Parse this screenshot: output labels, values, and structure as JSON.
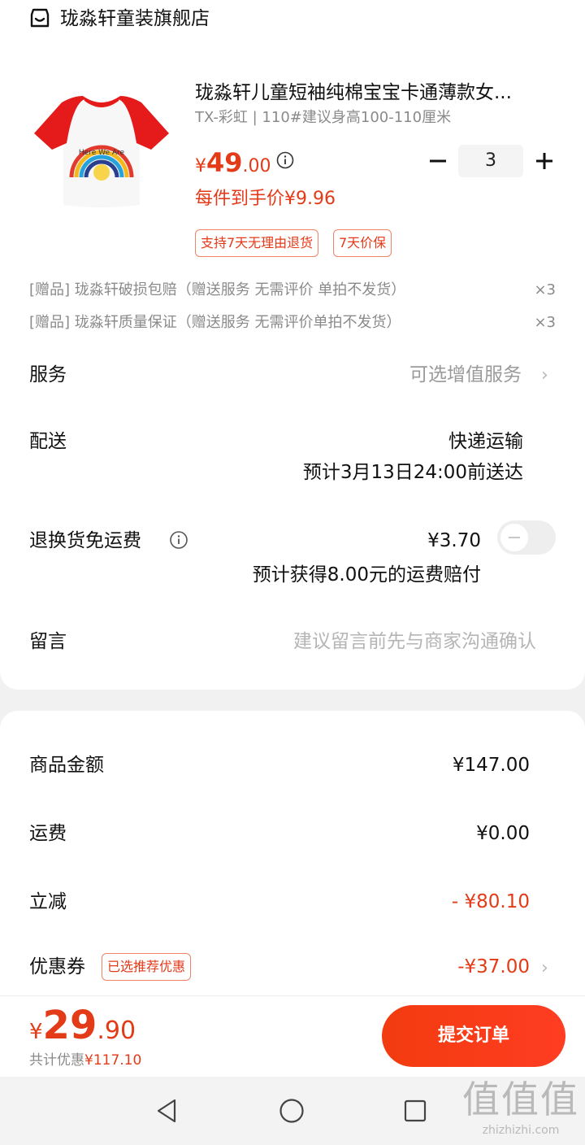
{
  "store": {
    "name": "珑淼轩童装旗舰店",
    "icon": "store-icon"
  },
  "product": {
    "title": "珑淼轩儿童短袖纯棉宝宝卡通薄款女...",
    "spec": "TX-彩虹 | 110#建议身高100-110厘米",
    "price": {
      "currency": "¥",
      "integer": "49",
      "decimal": ".00"
    },
    "unit_price": "每件到手价¥9.96",
    "quantity": "3",
    "tags": [
      "支持7天无理由退货",
      "7天价保"
    ],
    "image_text": "Here We Are"
  },
  "gifts": [
    {
      "text": "[赠品]  珑淼轩破损包赔（赠送服务 无需评价 单拍不发货）",
      "qty": "×3"
    },
    {
      "text": "[赠品]  珑淼轩质量保证（赠送服务 无需评价单拍不发货）",
      "qty": "×3"
    }
  ],
  "service": {
    "label": "服务",
    "value": "可选增值服务",
    "chevron": "›"
  },
  "delivery": {
    "label": "配送",
    "method": "快递运输",
    "eta": "预计3月13日24:00前送达"
  },
  "return_shipping": {
    "label": "退换货免运费",
    "price": "¥3.70",
    "note": "预计获得8.00元的运费赔付",
    "enabled": false
  },
  "message": {
    "label": "留言",
    "placeholder": "建议留言前先与商家沟通确认"
  },
  "summary": {
    "goods_label": "商品金额",
    "goods_value": "¥147.00",
    "shipping_label": "运费",
    "shipping_value": "¥0.00",
    "discount_label": "立减",
    "discount_value": "- ¥80.10",
    "coupon_label": "优惠券",
    "coupon_tag": "已选推荐优惠",
    "coupon_value": "-¥37.00",
    "coupon_chevron": "›"
  },
  "footer": {
    "total": {
      "currency": "¥",
      "integer": "29",
      "decimal": ".90"
    },
    "saved_label": "共计优惠",
    "saved_value": "¥117.10",
    "submit_label": "提交订单"
  },
  "watermark": {
    "big": "值值值",
    "small": "zhizhizhi.com"
  },
  "colors": {
    "accent": "#e33a18",
    "muted": "#8a8a8a",
    "background": "#f1f1f1"
  }
}
